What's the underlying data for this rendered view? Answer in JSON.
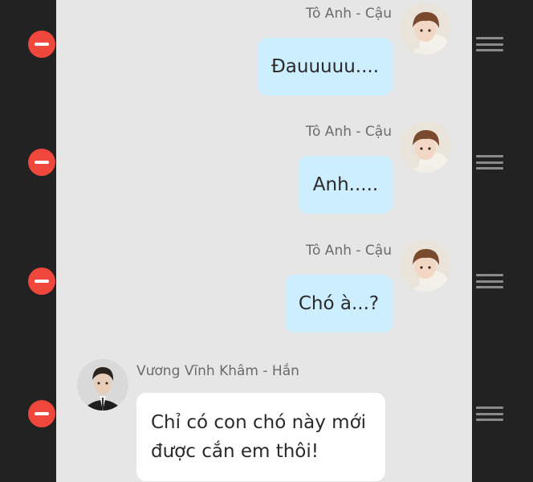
{
  "messages": [
    {
      "side": "right",
      "sender": "Tô Anh - Cậu",
      "text": "Đauuuuu...."
    },
    {
      "side": "right",
      "sender": "Tô Anh - Cậu",
      "text": "Anh....."
    },
    {
      "side": "right",
      "sender": "Tô Anh - Cậu",
      "text": "Chó à...?"
    },
    {
      "side": "left",
      "sender": "Vương Vĩnh Khâm - Hắn",
      "text": "Chỉ có con chó này mới được cắn em thôi!"
    }
  ],
  "icons": {
    "delete": "minus-circle-icon",
    "reorder": "drag-handle-icon",
    "avatar_right": "avatar-to-anh",
    "avatar_left": "avatar-vuong-vinh-kham"
  },
  "colors": {
    "background": "#222222",
    "chat_panel": "#e6e6e6",
    "bubble_right": "#cdeeff",
    "bubble_left": "#ffffff",
    "delete": "#f0473d"
  }
}
